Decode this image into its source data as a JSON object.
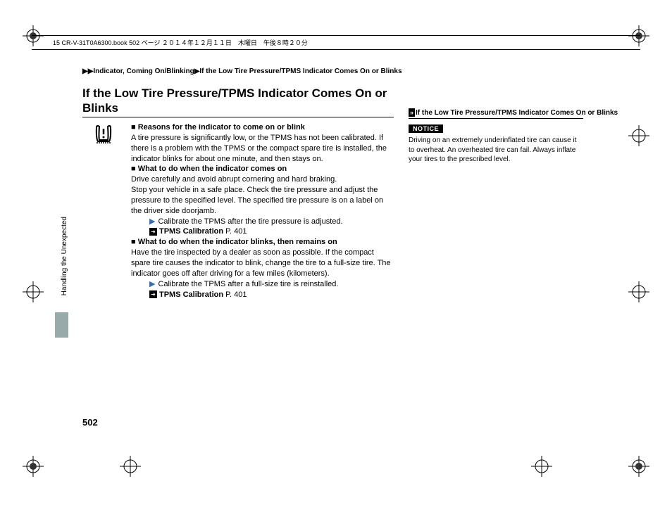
{
  "header": {
    "filename_line": "15 CR-V-31T0A6300.book  502 ページ  ２０１４年１２月１１日　木曜日　午後８時２０分"
  },
  "breadcrumb": "▶▶Indicator, Coming On/Blinking▶If the Low Tire Pressure/TPMS Indicator Comes On or Blinks",
  "title": "If the Low Tire Pressure/TPMS Indicator Comes On or Blinks",
  "content": {
    "reasons_heading": "Reasons for the indicator to come on or blink",
    "reasons_text": "A tire pressure is significantly low, or the TPMS has not been calibrated. If there is a problem with the TPMS or the compact spare tire is installed, the indicator blinks for about one minute, and then stays on.",
    "what_on_heading": "What to do when the indicator comes on",
    "what_on_text1": "Drive carefully and avoid abrupt cornering and hard braking.",
    "what_on_text2": "Stop your vehicle in a safe place. Check the tire pressure and adjust the pressure to the specified level. The specified tire pressure is on a label on the driver side doorjamb.",
    "what_on_action": "Calibrate the TPMS after the tire pressure is adjusted.",
    "ref1_label": "TPMS Calibration",
    "ref1_page": "P. 401",
    "what_blink_heading": "What to do when the indicator blinks, then remains on",
    "what_blink_text": "Have the tire inspected by a dealer as soon as possible. If the compact spare tire causes the indicator to blink, change the tire to a full-size tire. The indicator goes off after driving for a few miles (kilometers).",
    "what_blink_action": "Calibrate the TPMS after a full-size tire is reinstalled.",
    "ref2_label": "TPMS Calibration",
    "ref2_page": "P. 401"
  },
  "sidebar": {
    "title": "If the Low Tire Pressure/TPMS Indicator Comes On or Blinks",
    "notice_label": "NOTICE",
    "notice_text": "Driving on an extremely underinflated tire can cause it to overheat. An overheated tire can fail. Always inflate your tires to the prescribed level."
  },
  "chapter": "Handling the Unexpected",
  "page_number": "502"
}
